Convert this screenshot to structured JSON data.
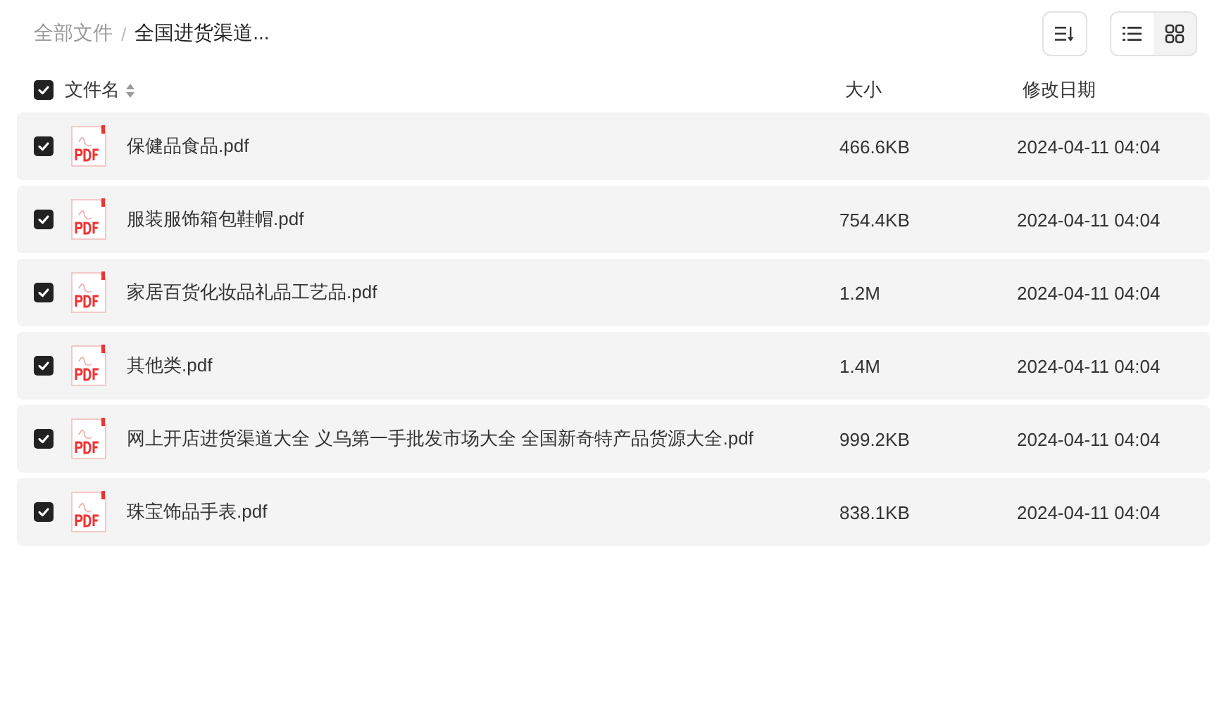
{
  "breadcrumb_separator": "/",
  "breadcrumb": [
    {
      "label": "全部文件",
      "current": false
    },
    {
      "label": "全国进货渠道...",
      "current": true
    }
  ],
  "toolbar": {
    "view_modes": [
      {
        "kind": "list",
        "selected": true
      },
      {
        "kind": "grid",
        "selected": false
      }
    ]
  },
  "table": {
    "all_checked": true,
    "columns": [
      {
        "label": "文件名",
        "sortable": true
      },
      {
        "label": "大小",
        "sortable": false
      },
      {
        "label": "修改日期",
        "sortable": false
      }
    ],
    "rows": [
      {
        "name": "保健品食品.pdf",
        "size": "466.6KB",
        "modified": "2024-04-11 04:04",
        "checked": true
      },
      {
        "name": "服装服饰箱包鞋帽.pdf",
        "size": "754.4KB",
        "modified": "2024-04-11 04:04",
        "checked": true
      },
      {
        "name": "家居百货化妆品礼品工艺品.pdf",
        "size": "1.2M",
        "modified": "2024-04-11 04:04",
        "checked": true
      },
      {
        "name": "其他类.pdf",
        "size": "1.4M",
        "modified": "2024-04-11 04:04",
        "checked": true
      },
      {
        "name": "网上开店进货渠道大全 义乌第一手批发市场大全 全国新奇特产品货源大全.pdf",
        "size": "999.2KB",
        "modified": "2024-04-11 04:04",
        "checked": true
      },
      {
        "name": "珠宝饰品手表.pdf",
        "size": "838.1KB",
        "modified": "2024-04-11 04:04",
        "checked": true
      }
    ]
  }
}
